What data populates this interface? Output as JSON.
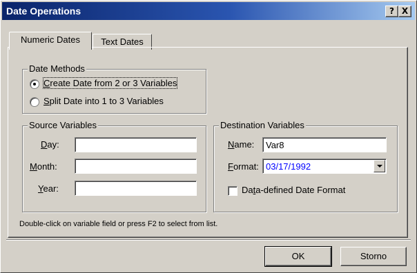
{
  "window": {
    "title": "Date Operations",
    "help_label": "?",
    "close_label": "X"
  },
  "tabs": [
    {
      "label": "Numeric Dates",
      "active": true
    },
    {
      "label": "Text Dates",
      "active": false
    }
  ],
  "date_methods": {
    "label": "Date Methods",
    "options": [
      {
        "mnemonic": "C",
        "rest": "reate Date from 2 or 3 Variables",
        "selected": true
      },
      {
        "mnemonic": "S",
        "rest": "plit Date into 1 to 3 Variables",
        "selected": false
      }
    ]
  },
  "source_variables": {
    "label": "Source Variables",
    "fields": [
      {
        "mnemonic": "D",
        "rest": "ay:",
        "value": ""
      },
      {
        "mnemonic": "M",
        "rest": "onth:",
        "value": ""
      },
      {
        "mnemonic": "Y",
        "rest": "ear:",
        "value": ""
      }
    ]
  },
  "destination_variables": {
    "label": "Destination Variables",
    "name_mnemonic": "N",
    "name_rest": "ame:",
    "name_value": "Var8",
    "format_mnemonic": "F",
    "format_rest": "ormat:",
    "format_value": "03/17/1992",
    "format_color": "#0000ff",
    "checkbox_pre": "Da",
    "checkbox_mnemonic": "t",
    "checkbox_rest": "a-defined Date Format",
    "checkbox_checked": false
  },
  "hint": "Double-click on variable field or press F2 to select from list.",
  "buttons": {
    "ok": "OK",
    "cancel": "Storno"
  }
}
